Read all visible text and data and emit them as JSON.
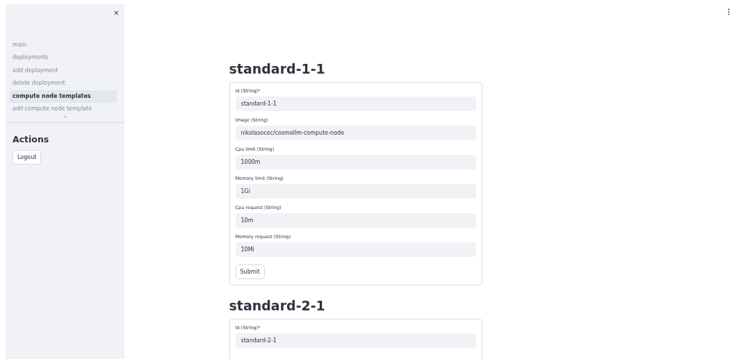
{
  "sidebar": {
    "close": "×",
    "nav_items": [
      {
        "label": "main",
        "selected": false
      },
      {
        "label": "deployments",
        "selected": false
      },
      {
        "label": "add deployment",
        "selected": false
      },
      {
        "label": "delete deployment",
        "selected": false
      },
      {
        "label": "compute node templates",
        "selected": true
      },
      {
        "label": "add compute node template",
        "selected": false
      }
    ],
    "actions_title": "Actions",
    "logout": "Logout"
  },
  "templates": [
    {
      "title": "standard-1-1",
      "fields": [
        {
          "label": "Id (String)*",
          "value": "standard-1-1"
        },
        {
          "label": "Image (String)",
          "value": "nikolasocec/cosmollm-compute-node"
        },
        {
          "label": "Cpu limit (String)",
          "value": "1000m"
        },
        {
          "label": "Memory limit (String)",
          "value": "1Gi"
        },
        {
          "label": "Cpu request (String)",
          "value": "10m"
        },
        {
          "label": "Memory request (String)",
          "value": "10Mi"
        }
      ],
      "submit": "Submit"
    },
    {
      "title": "standard-2-1",
      "fields": [
        {
          "label": "Id (String)*",
          "value": "standard-2-1"
        }
      ]
    }
  ]
}
